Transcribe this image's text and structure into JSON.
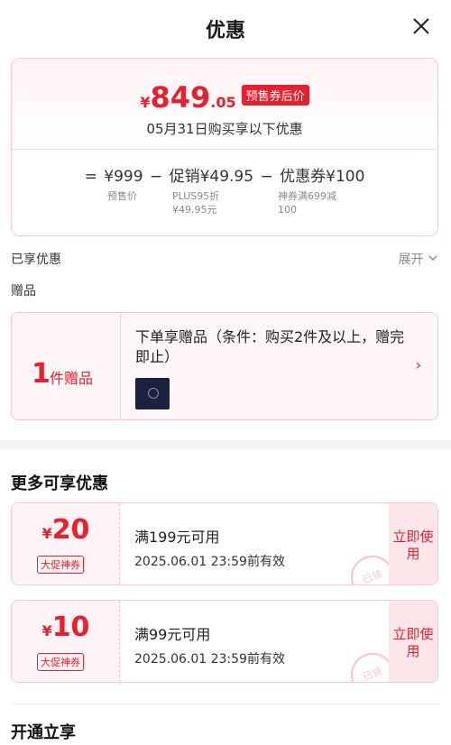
{
  "header": {
    "title": "优惠"
  },
  "price": {
    "currency": "¥",
    "integer": "849",
    "decimal": ".05",
    "badge": "预售券后价",
    "note": "05月31日购买享以下优惠",
    "formula": {
      "equals": "=",
      "presale_price": "¥999",
      "minus1": "−",
      "promo": "促销¥49.95",
      "minus2": "−",
      "coupon": "优惠券¥100"
    },
    "sub_labels": {
      "presale": "预售价",
      "promo_line1": "PLUS95折",
      "promo_line2": "¥49.95元",
      "coupon_line1": "神券满699减",
      "coupon_line2": "100"
    }
  },
  "enjoyed": {
    "label": "已享优惠",
    "expand": "展开"
  },
  "gift_section": {
    "label": "赠品"
  },
  "gift": {
    "count": "1",
    "unit": "件赠品",
    "text": "下单享赠品（条件：购买2件及以上，赠完即止）"
  },
  "more_offers": {
    "title": "更多可享优惠",
    "coupons": [
      {
        "currency": "¥",
        "amount": "20",
        "tag": "大促神券",
        "condition": "满199元可用",
        "expiry": "2025.06.01 23:59前有效",
        "button": "立即使用",
        "stamp": "已领"
      },
      {
        "currency": "¥",
        "amount": "10",
        "tag": "大促神券",
        "condition": "满99元可用",
        "expiry": "2025.06.01 23:59前有效",
        "button": "立即使用",
        "stamp": "已领"
      }
    ]
  },
  "open_section": {
    "title": "开通立享"
  }
}
